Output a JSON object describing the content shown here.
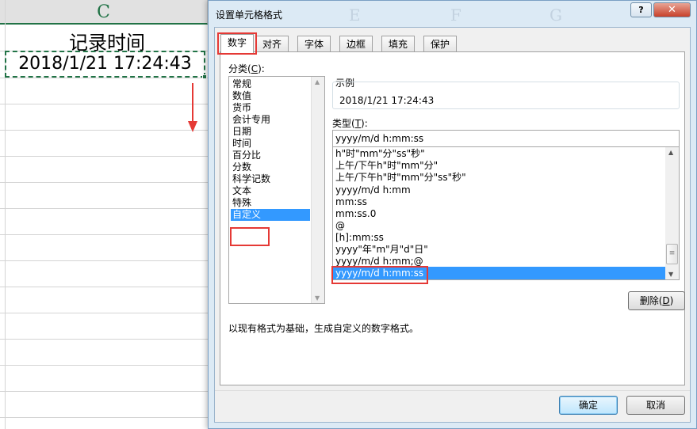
{
  "sheet": {
    "columns": [
      "C",
      "E",
      "F",
      "G"
    ],
    "cell_title": "记录时间",
    "cell_value": "2018/1/21 17:24:43"
  },
  "dialog": {
    "title": "设置单元格格式",
    "help_label": "?",
    "close_label": "✕",
    "tabs": [
      {
        "label": "数字",
        "active": true
      },
      {
        "label": "对齐"
      },
      {
        "label": "字体"
      },
      {
        "label": "边框"
      },
      {
        "label": "填充"
      },
      {
        "label": "保护"
      }
    ],
    "category_label_prefix": "分类(",
    "category_label_key": "C",
    "category_label_suffix": "):",
    "categories": [
      "常规",
      "数值",
      "货币",
      "会计专用",
      "日期",
      "时间",
      "百分比",
      "分数",
      "科学记数",
      "文本",
      "特殊",
      "自定义"
    ],
    "selected_category": "自定义",
    "sample_label": "示例",
    "sample_value": "2018/1/21 17:24:43",
    "type_label_prefix": "类型(",
    "type_label_key": "T",
    "type_label_suffix": "):",
    "type_value": "yyyy/m/d h:mm:ss",
    "formats": [
      "h\"时\"mm\"分\"ss\"秒\"",
      "上午/下午h\"时\"mm\"分\"",
      "上午/下午h\"时\"mm\"分\"ss\"秒\"",
      "yyyy/m/d h:mm",
      "mm:ss",
      "mm:ss.0",
      "@",
      "[h]:mm:ss",
      "yyyy\"年\"m\"月\"d\"日\"",
      "yyyy/m/d h:mm;@",
      "yyyy/m/d h:mm:ss"
    ],
    "selected_format": "yyyy/m/d h:mm:ss",
    "delete_label_prefix": "删除(",
    "delete_label_key": "D",
    "delete_label_suffix": ")",
    "description": "以现有格式为基础，生成自定义的数字格式。",
    "ok_label": "确定",
    "cancel_label": "取消"
  },
  "colors": {
    "highlight": "#e53935",
    "selection": "#3399ff",
    "excel_green": "#217346",
    "dialog_frame": "#dceaf5"
  }
}
